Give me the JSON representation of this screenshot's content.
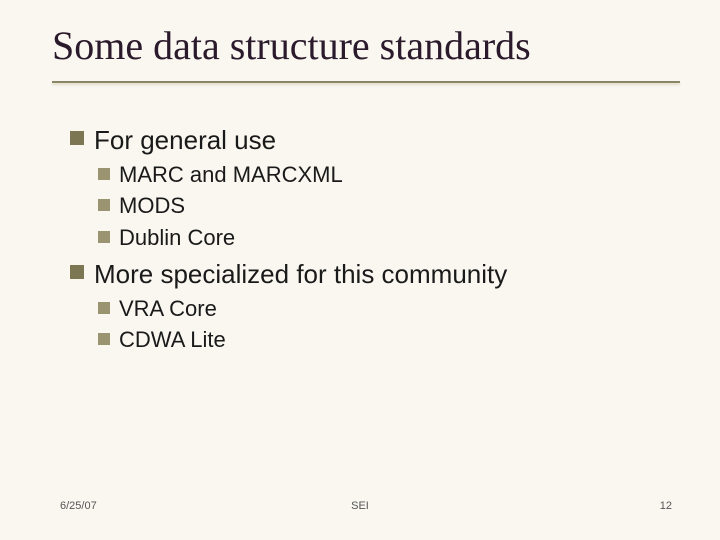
{
  "title": "Some data structure standards",
  "bullets": {
    "g1": {
      "label": "For general use",
      "items": [
        "MARC and MARCXML",
        "MODS",
        "Dublin Core"
      ]
    },
    "g2": {
      "label": "More specialized for this community",
      "items": [
        "VRA Core",
        "CDWA Lite"
      ]
    }
  },
  "footer": {
    "date": "6/25/07",
    "center": "SEI",
    "page": "12"
  }
}
